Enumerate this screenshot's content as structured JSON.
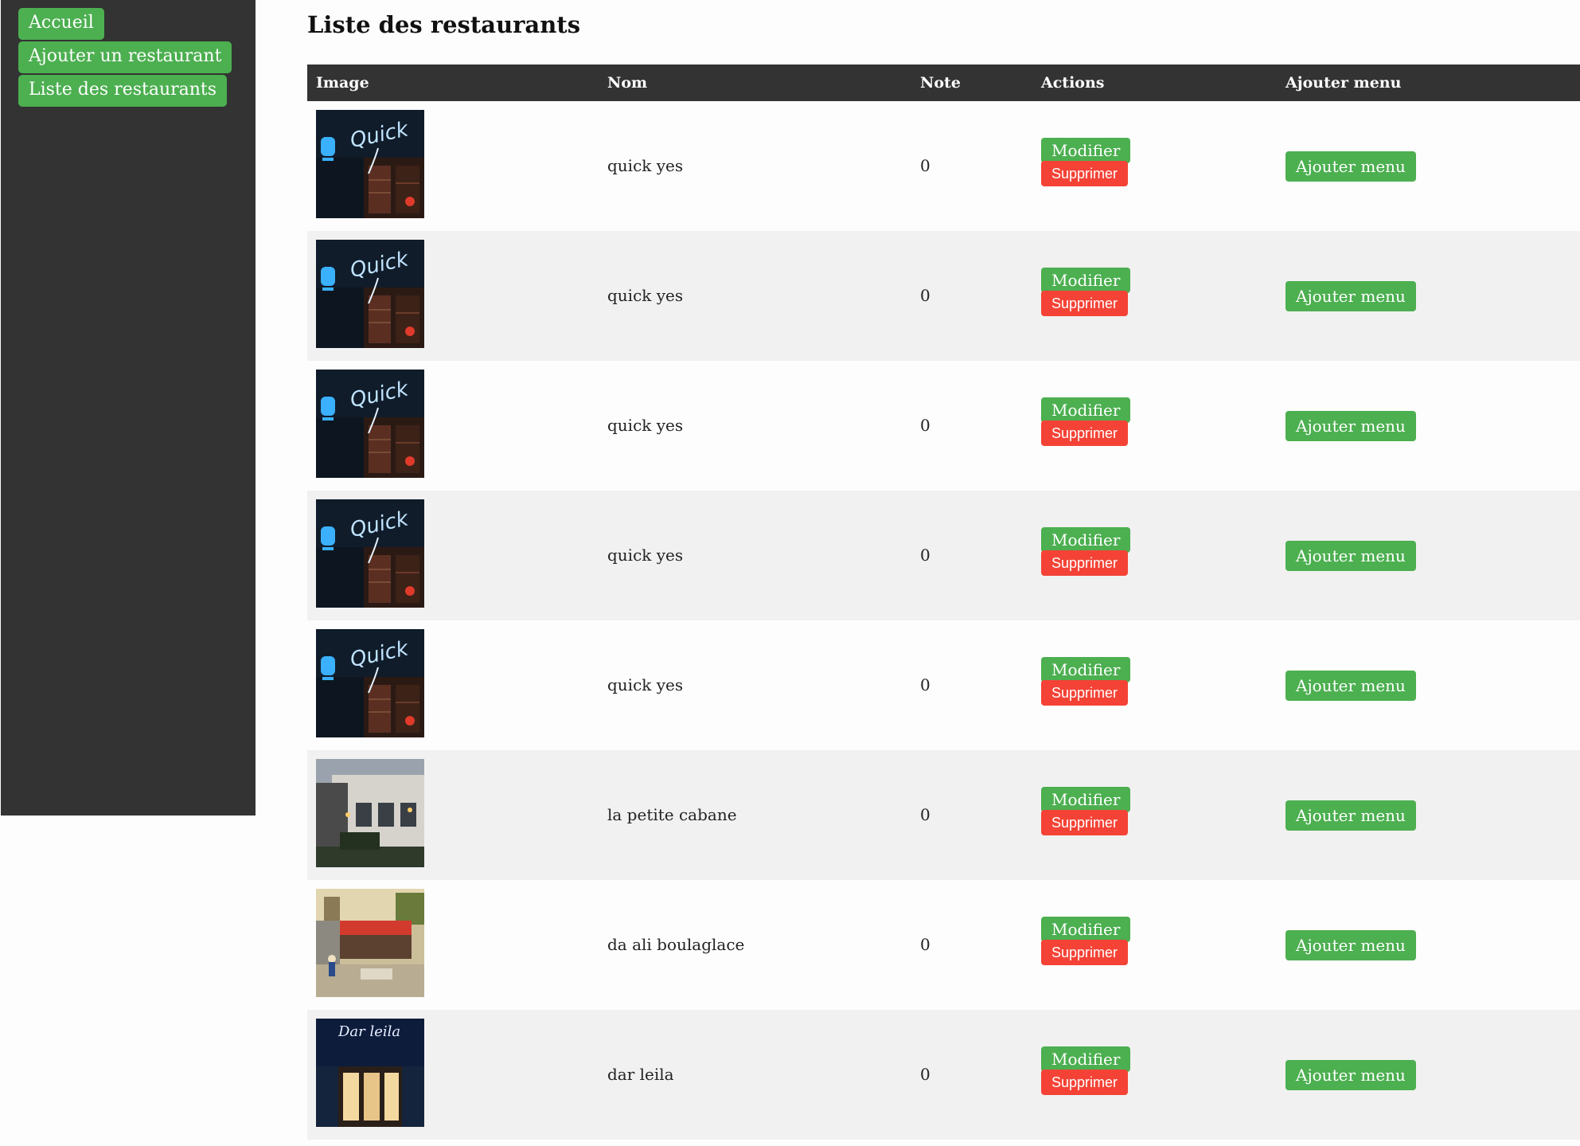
{
  "sidebar": {
    "items": [
      {
        "label": "Accueil"
      },
      {
        "label": "Ajouter un restaurant"
      },
      {
        "label": "Liste des restaurants"
      }
    ]
  },
  "main": {
    "title": "Liste des restaurants",
    "table": {
      "headers": {
        "image": "Image",
        "nom": "Nom",
        "note": "Note",
        "actions": "Actions",
        "ajouter_menu": "Ajouter menu"
      },
      "rows": [
        {
          "image": "quick-restaurant-photo",
          "nom": "quick yes",
          "note": "0",
          "modifier": "Modifier",
          "supprimer": "Supprimer",
          "ajouter_menu": "Ajouter menu"
        },
        {
          "image": "quick-restaurant-photo",
          "nom": "quick yes",
          "note": "0",
          "modifier": "Modifier",
          "supprimer": "Supprimer",
          "ajouter_menu": "Ajouter menu"
        },
        {
          "image": "quick-restaurant-photo",
          "nom": "quick yes",
          "note": "0",
          "modifier": "Modifier",
          "supprimer": "Supprimer",
          "ajouter_menu": "Ajouter menu"
        },
        {
          "image": "quick-restaurant-photo",
          "nom": "quick yes",
          "note": "0",
          "modifier": "Modifier",
          "supprimer": "Supprimer",
          "ajouter_menu": "Ajouter menu"
        },
        {
          "image": "quick-restaurant-photo",
          "nom": "quick yes",
          "note": "0",
          "modifier": "Modifier",
          "supprimer": "Supprimer",
          "ajouter_menu": "Ajouter menu"
        },
        {
          "image": "petite-cabane-photo",
          "nom": "la petite cabane",
          "note": "0",
          "modifier": "Modifier",
          "supprimer": "Supprimer",
          "ajouter_menu": "Ajouter menu"
        },
        {
          "image": "street-restaurant-photo",
          "nom": "da ali boulaglace",
          "note": "0",
          "modifier": "Modifier",
          "supprimer": "Supprimer",
          "ajouter_menu": "Ajouter menu"
        },
        {
          "image": "dar-leila-photo",
          "nom": "dar leila",
          "note": "0",
          "modifier": "Modifier",
          "supprimer": "Supprimer",
          "ajouter_menu": "Ajouter menu"
        }
      ]
    }
  },
  "colors": {
    "sidebar_bg": "#333333",
    "header_bg": "#333333",
    "green": "#4caf50",
    "red": "#f44336",
    "row_alt": "#f1f1f1"
  }
}
